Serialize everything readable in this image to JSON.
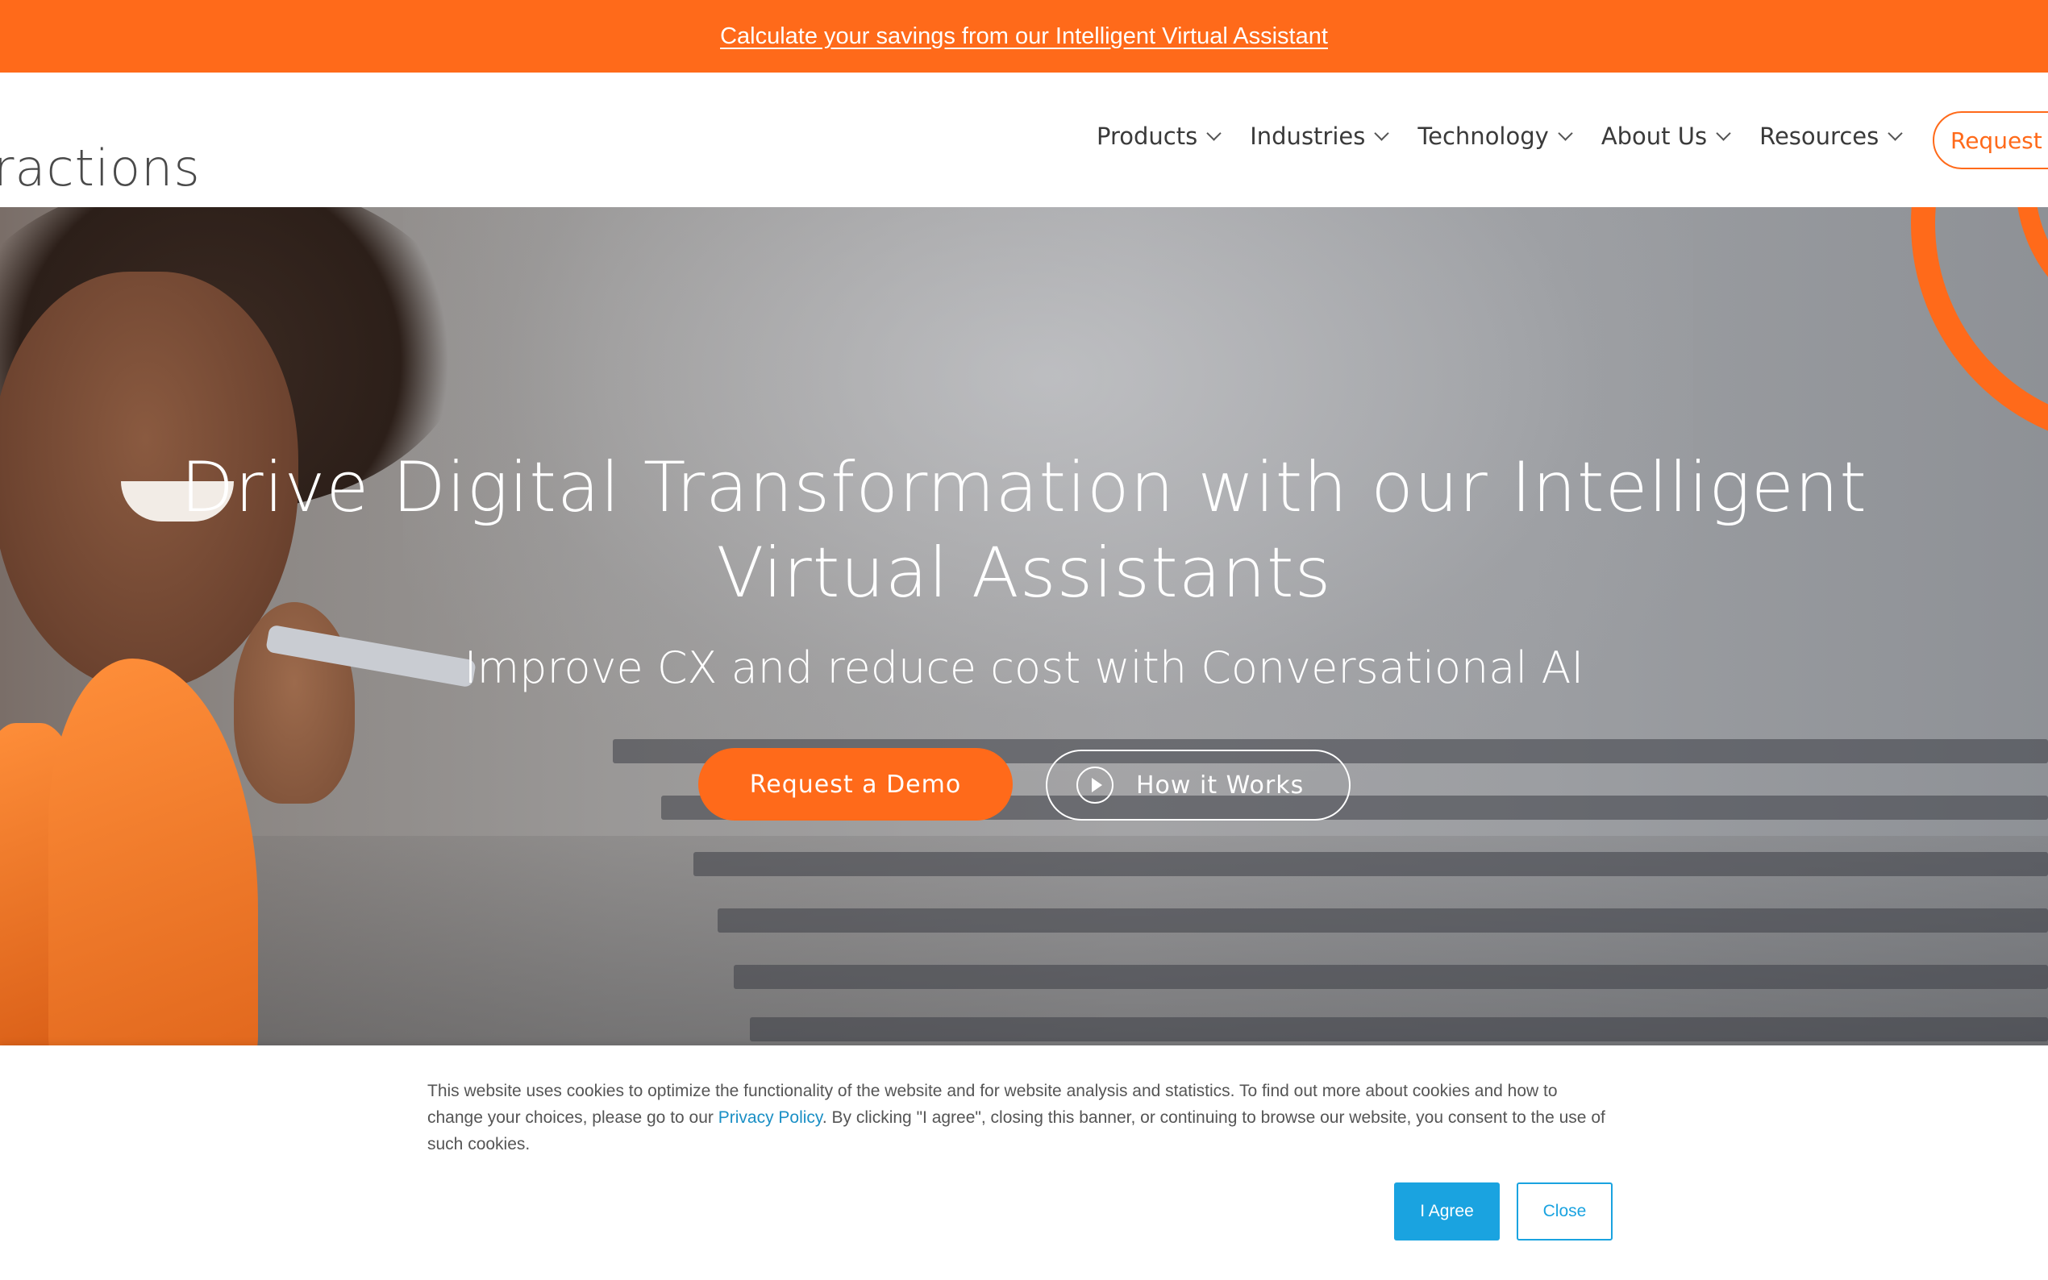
{
  "promo": {
    "link_text": "Calculate your savings from our Intelligent Virtual Assistant"
  },
  "header": {
    "logo_text": "ractions",
    "nav": [
      {
        "label": "Products"
      },
      {
        "label": "Industries"
      },
      {
        "label": "Technology"
      },
      {
        "label": "About Us"
      },
      {
        "label": "Resources"
      }
    ],
    "request_label": "Request"
  },
  "hero": {
    "headline_line1": "Drive Digital Transformation with our Intelligent",
    "headline_line2": "Virtual Assistants",
    "subhead": "Improve CX and reduce cost with Conversational AI",
    "demo_button": "Request a Demo",
    "how_button": "How it Works"
  },
  "cookie": {
    "text_part1": "This website uses cookies to optimize the functionality of the website and for website analysis and statistics. To find out more about cookies and how to change your choices, please go to our ",
    "privacy_link": "Privacy Policy",
    "text_part2": ". By clicking \"I agree\", closing this banner, or continuing to browse our website, you consent to the use of such cookies.",
    "agree_label": "I Agree",
    "close_label": "Close"
  },
  "colors": {
    "brand_orange": "#ff6a1a",
    "cookie_blue": "#1aa3e0"
  }
}
